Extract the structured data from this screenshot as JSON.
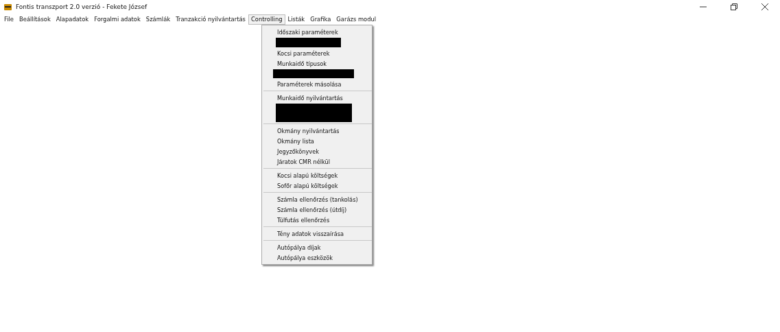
{
  "window": {
    "title": "Fontis transzport 2.0 verzió - Fekete József"
  },
  "menu_bar": [
    {
      "label": "File",
      "selected": false
    },
    {
      "label": "Beállítások",
      "selected": false
    },
    {
      "label": "Alapadatok",
      "selected": false
    },
    {
      "label": "Forgalmi adatok",
      "selected": false
    },
    {
      "label": "Számlák",
      "selected": false
    },
    {
      "label": "Tranzakció nyilvántartás",
      "selected": false
    },
    {
      "label": "Controlling",
      "selected": true
    },
    {
      "label": "Listák",
      "selected": false
    },
    {
      "label": "Grafika",
      "selected": false
    },
    {
      "label": "Garázs modul",
      "selected": false
    }
  ],
  "dropdown": {
    "groups": [
      [
        {
          "kind": "item",
          "label": "Időszaki paraméterek"
        },
        {
          "kind": "blackbar"
        },
        {
          "kind": "item",
          "label": "Kocsi paraméterek"
        },
        {
          "kind": "item",
          "label": "Munkaidő típusok"
        },
        {
          "kind": "blackwide"
        },
        {
          "kind": "item",
          "label": "Paraméterek másolása"
        }
      ],
      [
        {
          "kind": "item",
          "label": "Munkaidő nyilvántartás"
        },
        {
          "kind": "blackblock"
        }
      ],
      [
        {
          "kind": "item",
          "label": "Okmány nyilvántartás"
        },
        {
          "kind": "item",
          "label": "Okmány lista"
        },
        {
          "kind": "item",
          "label": "Jegyzőkönyvek"
        },
        {
          "kind": "item",
          "label": "Járatok CMR nélkül"
        }
      ],
      [
        {
          "kind": "item",
          "label": "Kocsi alapú költségek"
        },
        {
          "kind": "item",
          "label": "Sofőr alapú költségek"
        }
      ],
      [
        {
          "kind": "item",
          "label": "Számla ellenőrzés (tankolás)"
        },
        {
          "kind": "item",
          "label": "Számla ellenőrzés (útdíj)"
        },
        {
          "kind": "item",
          "label": "Túlfutás ellenőrzés"
        }
      ],
      [
        {
          "kind": "item",
          "label": "Tény adatok visszaírása"
        }
      ],
      [
        {
          "kind": "item",
          "label": "Autópálya díjak"
        },
        {
          "kind": "item",
          "label": "Autópálya eszközök"
        }
      ]
    ]
  }
}
